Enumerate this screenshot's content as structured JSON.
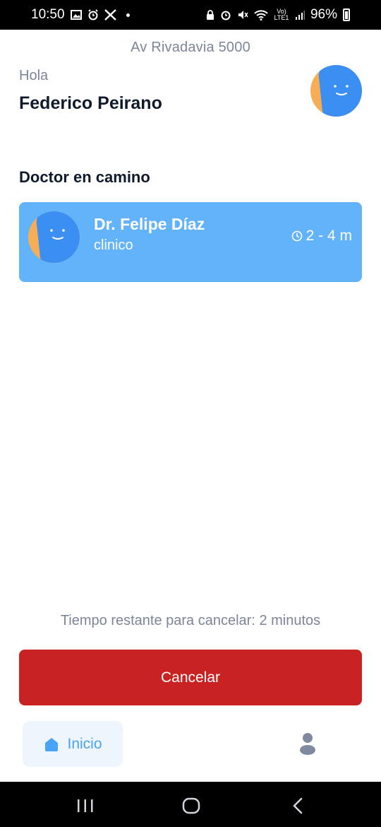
{
  "status_bar": {
    "time": "10:50",
    "battery": "96%",
    "network": "Vo) LTE1"
  },
  "header": {
    "address": "Av Rivadavia 5000",
    "greeting": "Hola",
    "user_name": "Federico Peirano"
  },
  "section": {
    "title": "Doctor en camino"
  },
  "doctor": {
    "name": "Dr. Felipe Díaz",
    "specialty": "clinico",
    "eta": "2 - 4 m"
  },
  "cancel": {
    "info": "Tiempo restante para cancelar: 2 minutos",
    "button_label": "Cancelar"
  },
  "bottom_nav": {
    "home_label": "Inicio"
  },
  "colors": {
    "card_blue": "#63b3fb",
    "avatar_blue": "#3b8ff2",
    "avatar_orange": "#f7ad55",
    "cancel_red": "#c82222",
    "muted_text": "#7a869a",
    "nav_active": "#4aa3f5",
    "nav_inactive": "#7f8aa1"
  },
  "icons": [
    "gallery-icon",
    "alarm-icon",
    "x-logo-icon",
    "wifi-icon",
    "signal-icon",
    "battery-icon",
    "clock-icon",
    "home-icon",
    "profile-icon",
    "recent-apps-icon",
    "home-circle-icon",
    "back-icon"
  ]
}
